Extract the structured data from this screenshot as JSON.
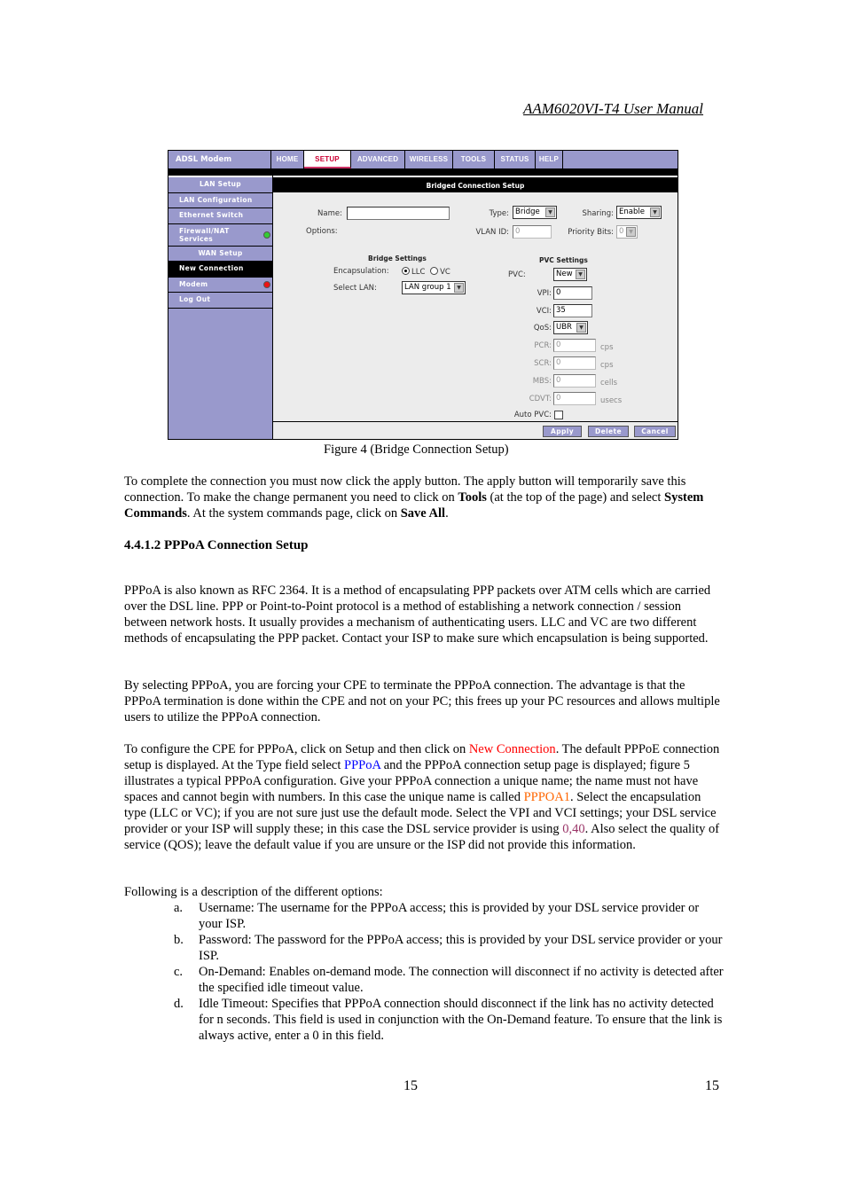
{
  "header": {
    "title": "AAM6020VI-T4 User Manual"
  },
  "figure": {
    "brand": "ADSL Modem",
    "nav_tabs": [
      {
        "label": "HOME",
        "active": false
      },
      {
        "label": "SETUP",
        "active": true
      },
      {
        "label": "ADVANCED",
        "active": false
      },
      {
        "label": "WIRELESS",
        "active": false
      },
      {
        "label": "TOOLS",
        "active": false
      },
      {
        "label": "STATUS",
        "active": false
      },
      {
        "label": "HELP",
        "active": false
      }
    ],
    "sidebar": [
      {
        "label": "LAN Setup",
        "type": "section"
      },
      {
        "label": "LAN Configuration",
        "type": "item"
      },
      {
        "label": "Ethernet Switch",
        "type": "item"
      },
      {
        "label": "Firewall/NAT Services",
        "type": "item",
        "status": "green"
      },
      {
        "label": "WAN Setup",
        "type": "section"
      },
      {
        "label": "New Connection",
        "type": "item",
        "active": true
      },
      {
        "label": "Modem",
        "type": "item",
        "status": "red"
      },
      {
        "label": "Log Out",
        "type": "item"
      }
    ],
    "page_title": "Bridged Connection Setup",
    "form": {
      "name_label": "Name:",
      "name_value": "",
      "options_label": "Options:",
      "type_label": "Type:",
      "type_value": "Bridge",
      "sharing_label": "Sharing:",
      "sharing_value": "Enable",
      "vlan_label": "VLAN ID:",
      "vlan_value": "0",
      "priority_label": "Priority Bits:",
      "priority_value": "0",
      "bridge_heading": "Bridge Settings",
      "encap_label": "Encapsulation:",
      "encap_options": [
        "LLC",
        "VC"
      ],
      "encap_selected": "LLC",
      "lan_label": "Select LAN:",
      "lan_value": "LAN group 1",
      "pvc_heading": "PVC Settings",
      "pvc_label": "PVC:",
      "pvc_value": "New",
      "vpi_label": "VPI:",
      "vpi_value": "0",
      "vci_label": "VCI:",
      "vci_value": "35",
      "qos_label": "QoS:",
      "qos_value": "UBR",
      "pcr_label": "PCR:",
      "pcr_value": "0",
      "pcr_unit": "cps",
      "scr_label": "SCR:",
      "scr_value": "0",
      "scr_unit": "cps",
      "mbs_label": "MBS:",
      "mbs_value": "0",
      "mbs_unit": "cells",
      "cdvt_label": "CDVT:",
      "cdvt_value": "0",
      "cdvt_unit": "usecs",
      "autopvc_label": "Auto PVC:",
      "autopvc_checked": false
    },
    "buttons": {
      "apply": "Apply",
      "delete": "Delete",
      "cancel": "Cancel"
    }
  },
  "caption": "Figure 4 (Bridge Connection Setup)",
  "para1": {
    "t1": "To complete the connection  you must now click the apply button.  The apply button will temporarily save this connection. To make the change permanent you need to click on ",
    "b1": "Tools",
    "t2": " (at the top of the page) and select ",
    "b2": "System Commands",
    "t3": ".  At the system commands page, click on ",
    "b3": "Save All",
    "t4": "."
  },
  "section_heading": "4.4.1.2  PPPoA  Connection Setup",
  "para2": "PPPoA is also known as RFC 2364. It is a method of encapsulating PPP packets over ATM cells which are carried over the DSL line. PPP or Point-to-Point protocol is a method of establishing a network connection / session between network hosts. It usually provides a mechanism of authenticating users.  LLC and VC are two different methods of encapsulating the PPP packet. Contact your ISP to make sure which encapsulation is being supported.",
  "para3": "By selecting PPPoA, you are forcing your CPE to terminate the PPPoA connection.  The advantage is that the PPPoA termination is done within the CPE and not on your PC; this frees up your PC resources and allows multiple users to utilize the PPPoA connection.",
  "para4": {
    "t1": "To configure the CPE for PPPoA,  click on Setup and then click on ",
    "h1": "New Connection",
    "t2": ".  The default PPPoE connection setup is displayed.  At the Type field select ",
    "h2": "PPPoA",
    "t3": " and the PPPoA connection setup page is displayed; figure 5 illustrates a typical PPPoA configuration.  Give your PPPoA connection a unique name; the name must not have spaces and cannot begin with numbers.  In this case the unique name is called ",
    "h3": "PPPOA1",
    "t4": ".  Select the encapsulation type (LLC or VC); if you are not sure just use the default mode.  Select the VPI and VCI settings; your DSL service provider or your ISP will supply these; in this case the DSL service provider is using ",
    "h4": "0,40",
    "t5": ".  Also select the quality of service (QOS); leave the default value if you are unsure or the ISP did not provide this information.",
    "colors": {
      "h1": "#ff0000",
      "h2": "#0000ff",
      "h3": "#ff6600",
      "h4": "#993366"
    }
  },
  "list_intro": "Following is a description of the different options:",
  "options": [
    {
      "marker": "a.",
      "text": "Username: The username for the PPPoA access; this is provided by your DSL service provider or your ISP."
    },
    {
      "marker": "b.",
      "text": "Password: The password for the PPPoA access; this is provided by your DSL service provider or your ISP."
    },
    {
      "marker": "c.",
      "text": "On-Demand: Enables on-demand mode. The connection will disconnect if no activity is detected after the specified idle timeout value."
    },
    {
      "marker": "d.",
      "text": "Idle Timeout: Specifies that PPPoA connection should disconnect if the link has no activity detected for n seconds.  This field is used in conjunction with the On-Demand feature. To ensure that the link is always active, enter a 0 in this field."
    }
  ],
  "footer": {
    "page_center": "15",
    "page_right": "15"
  }
}
